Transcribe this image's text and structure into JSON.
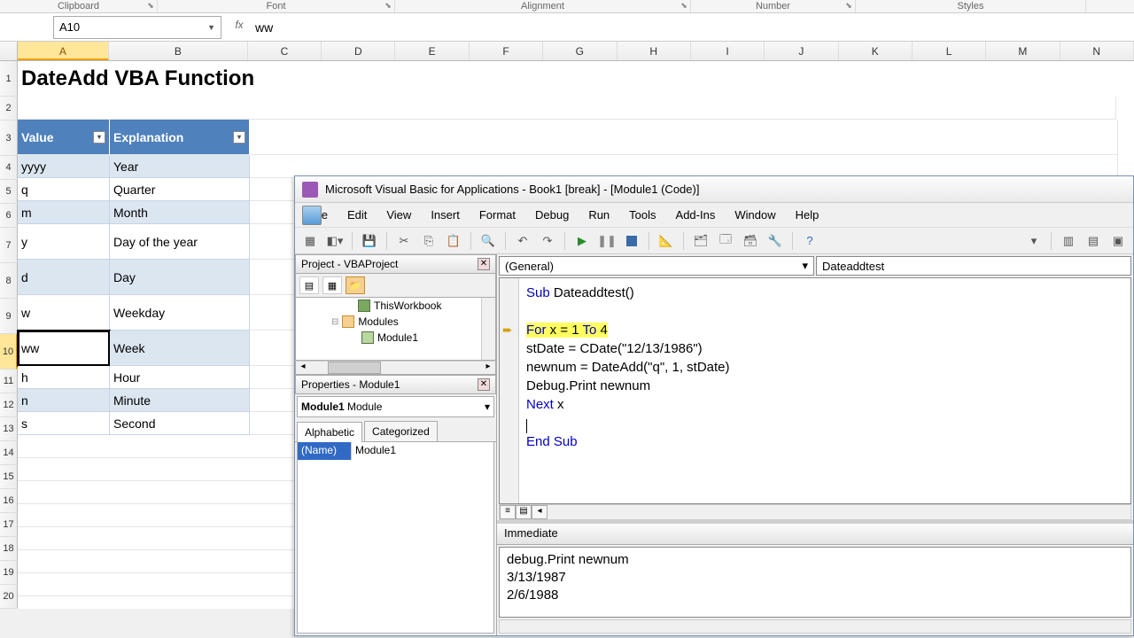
{
  "ribbon": {
    "groups": [
      "Clipboard",
      "Font",
      "Alignment",
      "Number",
      "Styles"
    ]
  },
  "namebox": "A10",
  "formula": "ww",
  "columns": [
    "A",
    "B",
    "C",
    "D",
    "E",
    "F",
    "G",
    "H",
    "I",
    "J",
    "K",
    "L",
    "M",
    "N"
  ],
  "rows": [
    "1",
    "2",
    "3",
    "4",
    "5",
    "6",
    "7",
    "8",
    "9",
    "10",
    "11",
    "12",
    "13",
    "14",
    "15",
    "16",
    "17",
    "18",
    "19",
    "20"
  ],
  "title_cell": "DateAdd VBA Function",
  "table": {
    "headers": [
      "Value",
      "Explanation"
    ],
    "rows": [
      {
        "v": "yyyy",
        "e": "Year"
      },
      {
        "v": "q",
        "e": "Quarter"
      },
      {
        "v": "m",
        "e": "Month"
      },
      {
        "v": "y",
        "e": "Day of the year"
      },
      {
        "v": "d",
        "e": "Day"
      },
      {
        "v": "w",
        "e": "Weekday"
      },
      {
        "v": "ww",
        "e": "Week"
      },
      {
        "v": "h",
        "e": "Hour"
      },
      {
        "v": "n",
        "e": "Minute"
      },
      {
        "v": "s",
        "e": "Second"
      }
    ]
  },
  "vba": {
    "title": "Microsoft Visual Basic for Applications - Book1 [break] - [Module1 (Code)]",
    "menu": [
      "File",
      "Edit",
      "View",
      "Insert",
      "Format",
      "Debug",
      "Run",
      "Tools",
      "Add-Ins",
      "Window",
      "Help"
    ],
    "project_title": "Project - VBAProject",
    "tree": {
      "thiswb": "ThisWorkbook",
      "modules": "Modules",
      "module1": "Module1"
    },
    "props_title": "Properties - Module1",
    "props_combo_bold": "Module1",
    "props_combo_rest": " Module",
    "props_tabs": [
      "Alphabetic",
      "Categorized"
    ],
    "prop_name_label": "(Name)",
    "prop_name_value": "Module1",
    "combo_left": "(General)",
    "combo_right": "Dateaddtest",
    "code": {
      "l1a": "Sub",
      "l1b": " Dateaddtest()",
      "l2a": "For",
      "l2b": " x = 1 ",
      "l2c": "To",
      "l2d": " 4",
      "l3": "    stDate = CDate(\"12/13/1986\")",
      "l4": "    newnum = DateAdd(\"q\", 1, stDate)",
      "l5": "    Debug.Print newnum",
      "l6a": "Next",
      "l6b": " x",
      "l7a": "End Sub"
    },
    "immediate_title": "Immediate",
    "immediate_lines": [
      "debug.Print newnum",
      "3/13/1987",
      "2/6/1988"
    ]
  }
}
